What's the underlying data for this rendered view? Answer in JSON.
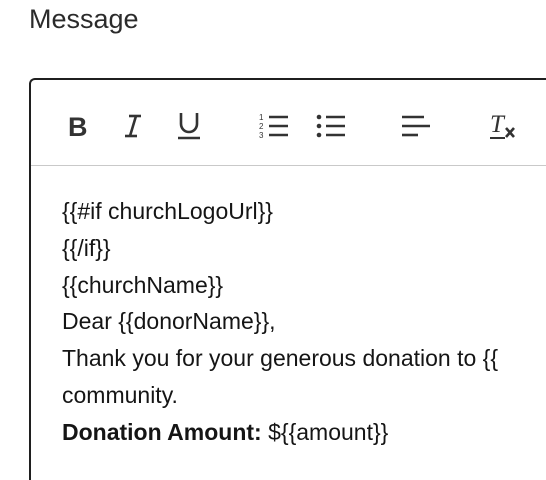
{
  "field": {
    "label": "Message"
  },
  "toolbar": {
    "buttons": [
      {
        "name": "bold",
        "icon": "bold-icon"
      },
      {
        "name": "italic",
        "icon": "italic-icon"
      },
      {
        "name": "underline",
        "icon": "underline-icon"
      },
      {
        "name": "ordered-list",
        "icon": "ordered-list-icon"
      },
      {
        "name": "bullet-list",
        "icon": "bullet-list-icon"
      },
      {
        "name": "align-left",
        "icon": "align-left-icon"
      },
      {
        "name": "clear-formatting",
        "icon": "clear-formatting-icon"
      }
    ]
  },
  "content": {
    "line1": "{{#if churchLogoUrl}}",
    "line2": "{{/if}}",
    "line3": "{{churchName}}",
    "line4": "Dear {{donorName}},",
    "line5": "Thank you for your generous donation to {{",
    "line6": "community.",
    "line7_label": "Donation Amount:",
    "line7_value": " ${{amount}}"
  },
  "colors": {
    "border": "#1f1f1f",
    "divider": "#c9c9c9",
    "icon": "#333333",
    "text": "#151515"
  }
}
